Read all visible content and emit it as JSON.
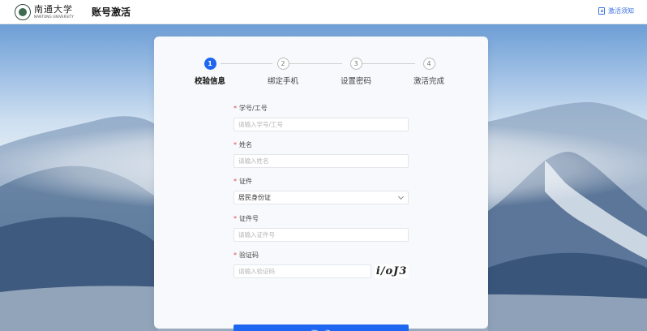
{
  "header": {
    "logo_cn": "南通大学",
    "logo_en": "NANTONG UNIVERSITY",
    "title": "账号激活",
    "notice_label": "激活须知",
    "notice_icon": "document-icon"
  },
  "steps": [
    {
      "number": "1",
      "label": "校验信息",
      "active": true
    },
    {
      "number": "2",
      "label": "绑定手机",
      "active": false
    },
    {
      "number": "3",
      "label": "设置密码",
      "active": false
    },
    {
      "number": "4",
      "label": "激活完成",
      "active": false
    }
  ],
  "form": {
    "required_mark": "*",
    "student_id": {
      "label": "学号/工号",
      "placeholder": "请输入学号/工号",
      "value": ""
    },
    "name": {
      "label": "姓名",
      "placeholder": "请输入姓名",
      "value": ""
    },
    "id_type": {
      "label": "证件",
      "value": "居民身份证"
    },
    "id_number": {
      "label": "证件号",
      "placeholder": "请输入证件号",
      "value": ""
    },
    "captcha": {
      "label": "验证码",
      "placeholder": "请输入验证码",
      "value": "",
      "image_text": "i/oJ3"
    },
    "next_label": "下一步"
  },
  "colors": {
    "accent": "#1f66f0",
    "required": "#e5484d",
    "link": "#3b6fe0"
  }
}
